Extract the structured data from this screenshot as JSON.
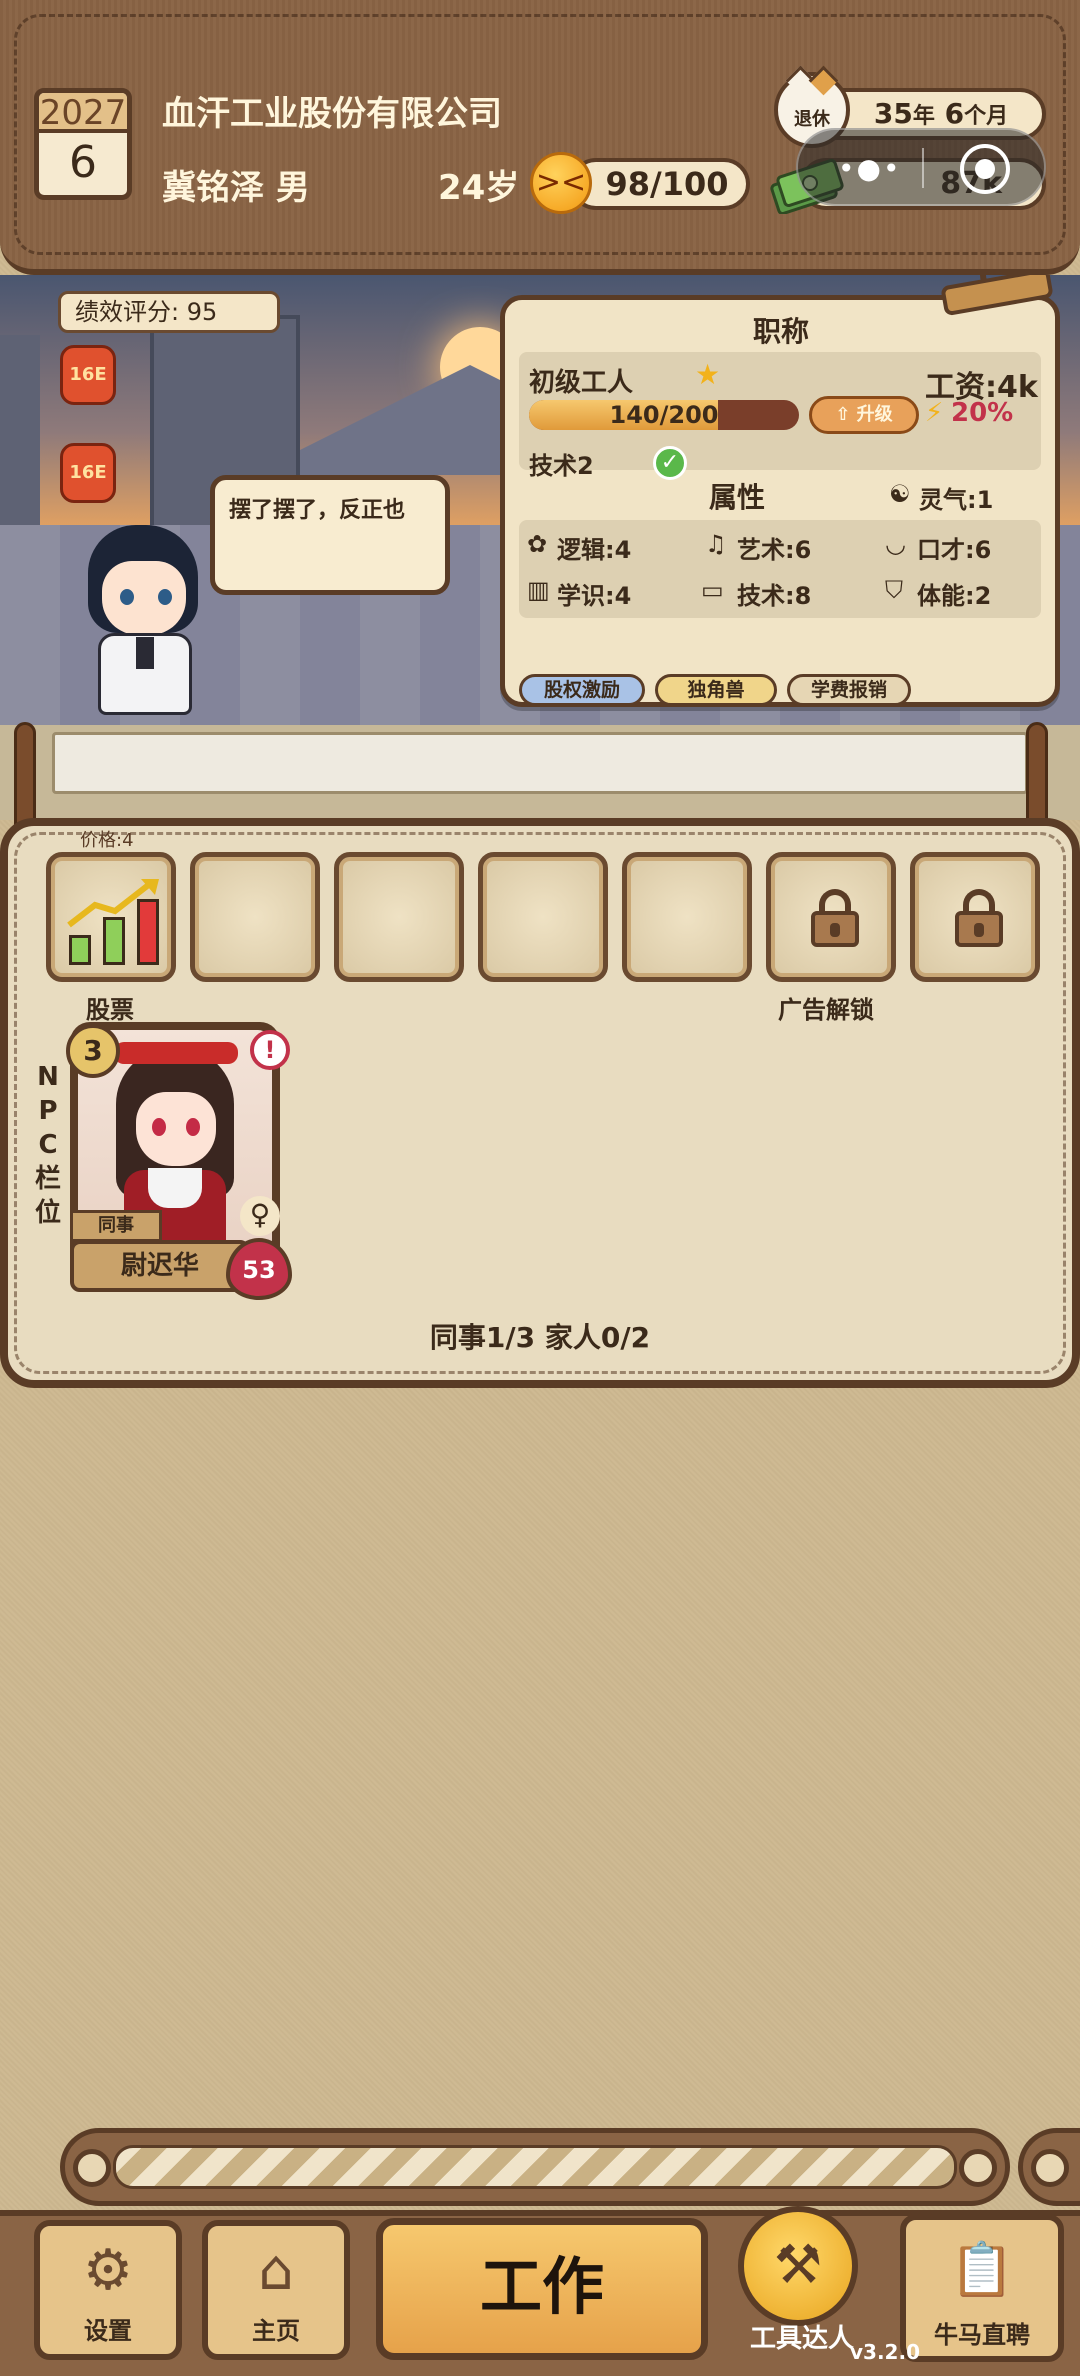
{
  "header": {
    "calendar_year": "2027",
    "calendar_month": "6",
    "company": "血汗工业股份有限公司",
    "player": "冀铭泽 男",
    "age": "24岁",
    "mood": "98/100",
    "retire_badge": "退休",
    "retire_years": "35",
    "retire_year_unit": "年",
    "retire_months": "6",
    "retire_month_unit": "个月",
    "money": "87k"
  },
  "scene": {
    "performance": "绩效评分: 95",
    "speech": "摆了摆了，反正也",
    "lantern": "16E"
  },
  "job_panel": {
    "title": "职称",
    "rank": "初级工人",
    "salary": "工资:4k",
    "exp_text": "140/200",
    "exp_progress": 0.7,
    "upgrade": "升级",
    "bonus": "20%",
    "skill_req": "技术2",
    "attr_title": "属性",
    "aura": "灵气:1",
    "attrs": {
      "logic": "逻辑:4",
      "art": "艺术:6",
      "eloquence": "口才:6",
      "knowledge": "学识:4",
      "tech": "技术:8",
      "stamina": "体能:2"
    },
    "tags": [
      "股权激励",
      "独角兽",
      "学费报销"
    ]
  },
  "npc": {
    "price": "价格:4",
    "slot_stock": "股票",
    "slot_ad": "广告解锁",
    "side_label": [
      "N",
      "P",
      "C",
      "栏",
      "位"
    ],
    "card": {
      "level": "3",
      "alert": "!",
      "role": "同事",
      "gender": "♀",
      "name": "尉迟华",
      "heart": "53"
    },
    "count": "同事1/3 家人0/2"
  },
  "bottom": {
    "settings": "设置",
    "home": "主页",
    "work": "工作",
    "tool": "工具达人",
    "hire": "牛马直聘",
    "version": "v3.2.0"
  },
  "colors": {
    "wood": "#8a6445",
    "dark_wood": "#5a3c26",
    "parchment": "#f1e4c6",
    "accent_orange": "#e6a24a",
    "heart_red": "#c2324a"
  }
}
